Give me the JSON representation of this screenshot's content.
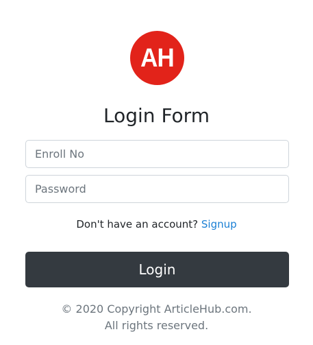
{
  "logo": {
    "text": "AH",
    "color": "#e2231a"
  },
  "form": {
    "title": "Login Form",
    "enroll_placeholder": "Enroll No",
    "password_placeholder": "Password",
    "no_account_text": "Don't have an account?",
    "signup_label": "Signup",
    "login_label": "Login",
    "button_color": "#343a40",
    "link_color": "#1a7fd4"
  },
  "footer": {
    "line1": "© 2020 Copyright ArticleHub.com.",
    "line2": "All rights reserved."
  }
}
